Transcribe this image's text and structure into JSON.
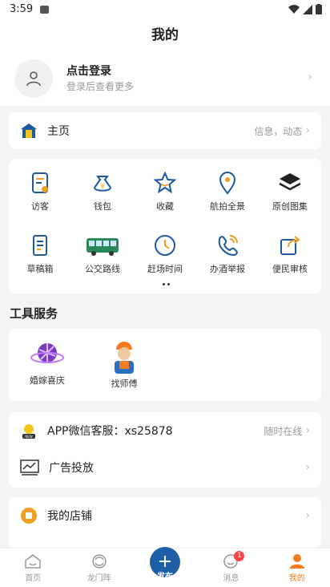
{
  "status": {
    "time": "3:59"
  },
  "header": {
    "title": "我的"
  },
  "login": {
    "title": "点击登录",
    "subtitle": "登录后查看更多"
  },
  "home": {
    "label": "主页",
    "aside": "信息，动态"
  },
  "grid": {
    "items": [
      {
        "label": "访客",
        "icon": "visitor-icon"
      },
      {
        "label": "钱包",
        "icon": "wallet-icon"
      },
      {
        "label": "收藏",
        "icon": "star-icon"
      },
      {
        "label": "航拍全景",
        "icon": "location-icon"
      },
      {
        "label": "原创图集",
        "icon": "layers-icon"
      },
      {
        "label": "草稿箱",
        "icon": "draft-icon"
      },
      {
        "label": "公交路线",
        "icon": "bus-icon"
      },
      {
        "label": "赶场时间",
        "icon": "clock-icon"
      },
      {
        "label": "办酒举报",
        "icon": "report-icon"
      },
      {
        "label": "便民审核",
        "icon": "share-review-icon"
      }
    ]
  },
  "tools": {
    "title": "工具服务",
    "items": [
      {
        "label": "婚嫁喜庆",
        "icon": "wedding-icon"
      },
      {
        "label": "找师傅",
        "icon": "worker-icon"
      }
    ]
  },
  "service": {
    "label": "APP微信客服：xs25878",
    "aside": "随时在线"
  },
  "ads": {
    "label": "广告投放"
  },
  "shop": {
    "label": "我的店铺"
  },
  "tabbar": {
    "items": [
      {
        "label": "首页"
      },
      {
        "label": "龙门阵"
      },
      {
        "label": "发布"
      },
      {
        "label": "消息",
        "badge": "1"
      },
      {
        "label": "我的"
      }
    ]
  },
  "colors": {
    "accent": "#f47c20",
    "publish": "#1f5fa8",
    "icon_blue": "#1e5aa0",
    "icon_orange": "#f0a020"
  }
}
